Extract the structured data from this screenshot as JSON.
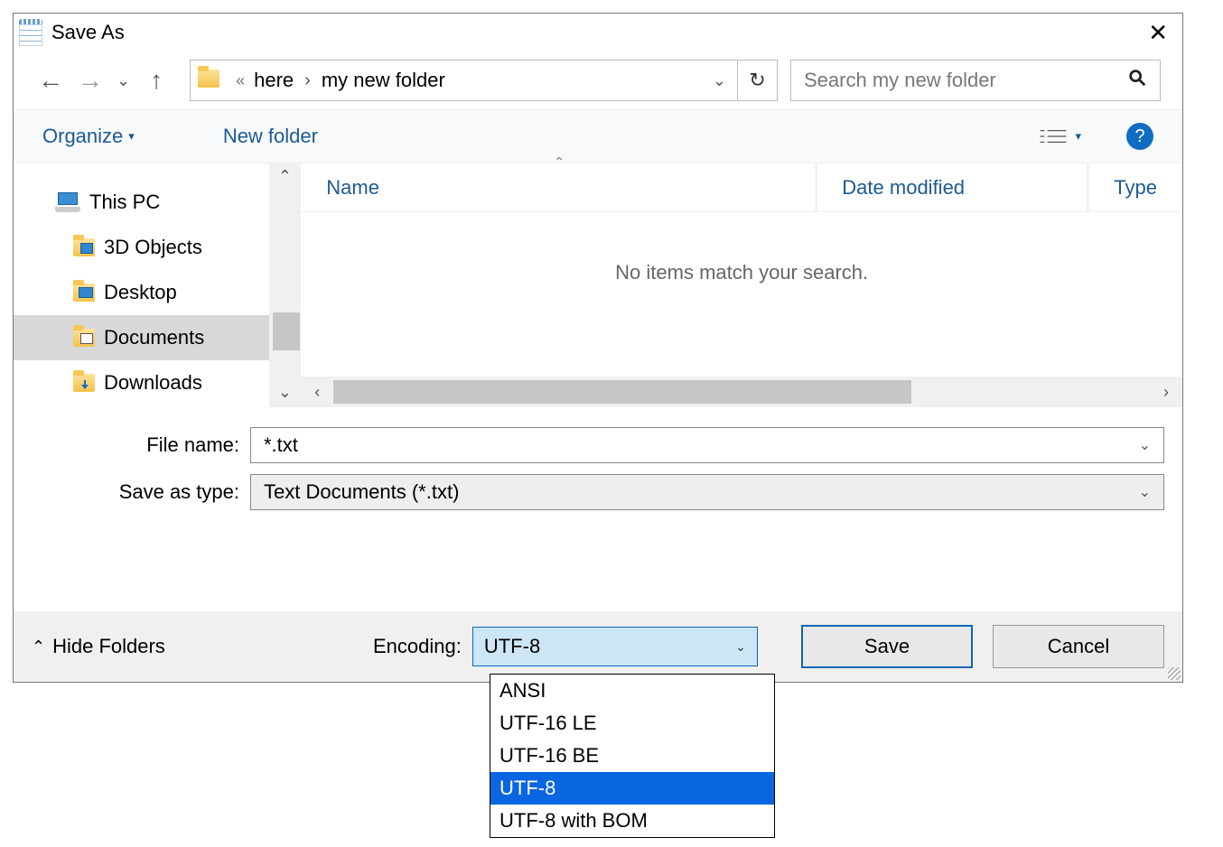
{
  "dialog": {
    "title": "Save As",
    "close_icon": "✕"
  },
  "nav": {
    "back_arrow": "←",
    "forward_arrow": "→",
    "up_arrow": "↑",
    "chevron_down": "⌄",
    "address": {
      "quote": "«",
      "segment1": "here",
      "separator": "›",
      "segment2": "my new folder",
      "end_chevron": "⌄",
      "refresh": "↻"
    },
    "search_placeholder": "Search my new folder"
  },
  "toolbar": {
    "organize": "Organize",
    "organize_caret": "▾",
    "new_folder": "New folder",
    "view_caret": "▾",
    "help": "?"
  },
  "sidebar": {
    "items": [
      {
        "label": "This PC",
        "type": "pc"
      },
      {
        "label": "3D Objects",
        "type": "folder-blue"
      },
      {
        "label": "Desktop",
        "type": "folder-desk"
      },
      {
        "label": "Documents",
        "type": "folder-doc",
        "selected": true
      },
      {
        "label": "Downloads",
        "type": "folder-dl"
      }
    ]
  },
  "columns": {
    "name": "Name",
    "date": "Date modified",
    "type": "Type"
  },
  "empty_message": "No items match your search.",
  "fields": {
    "file_name_label": "File name:",
    "file_name_value": "*.txt",
    "save_as_type_label": "Save as type:",
    "save_as_type_value": "Text Documents (*.txt)"
  },
  "footer": {
    "hide_folders": "Hide Folders",
    "hide_caret": "⌃",
    "encoding_label": "Encoding:",
    "encoding_value": "UTF-8",
    "encoding_options": [
      "ANSI",
      "UTF-16 LE",
      "UTF-16 BE",
      "UTF-8",
      "UTF-8 with BOM"
    ],
    "encoding_highlight": "UTF-8",
    "save": "Save",
    "cancel": "Cancel"
  }
}
